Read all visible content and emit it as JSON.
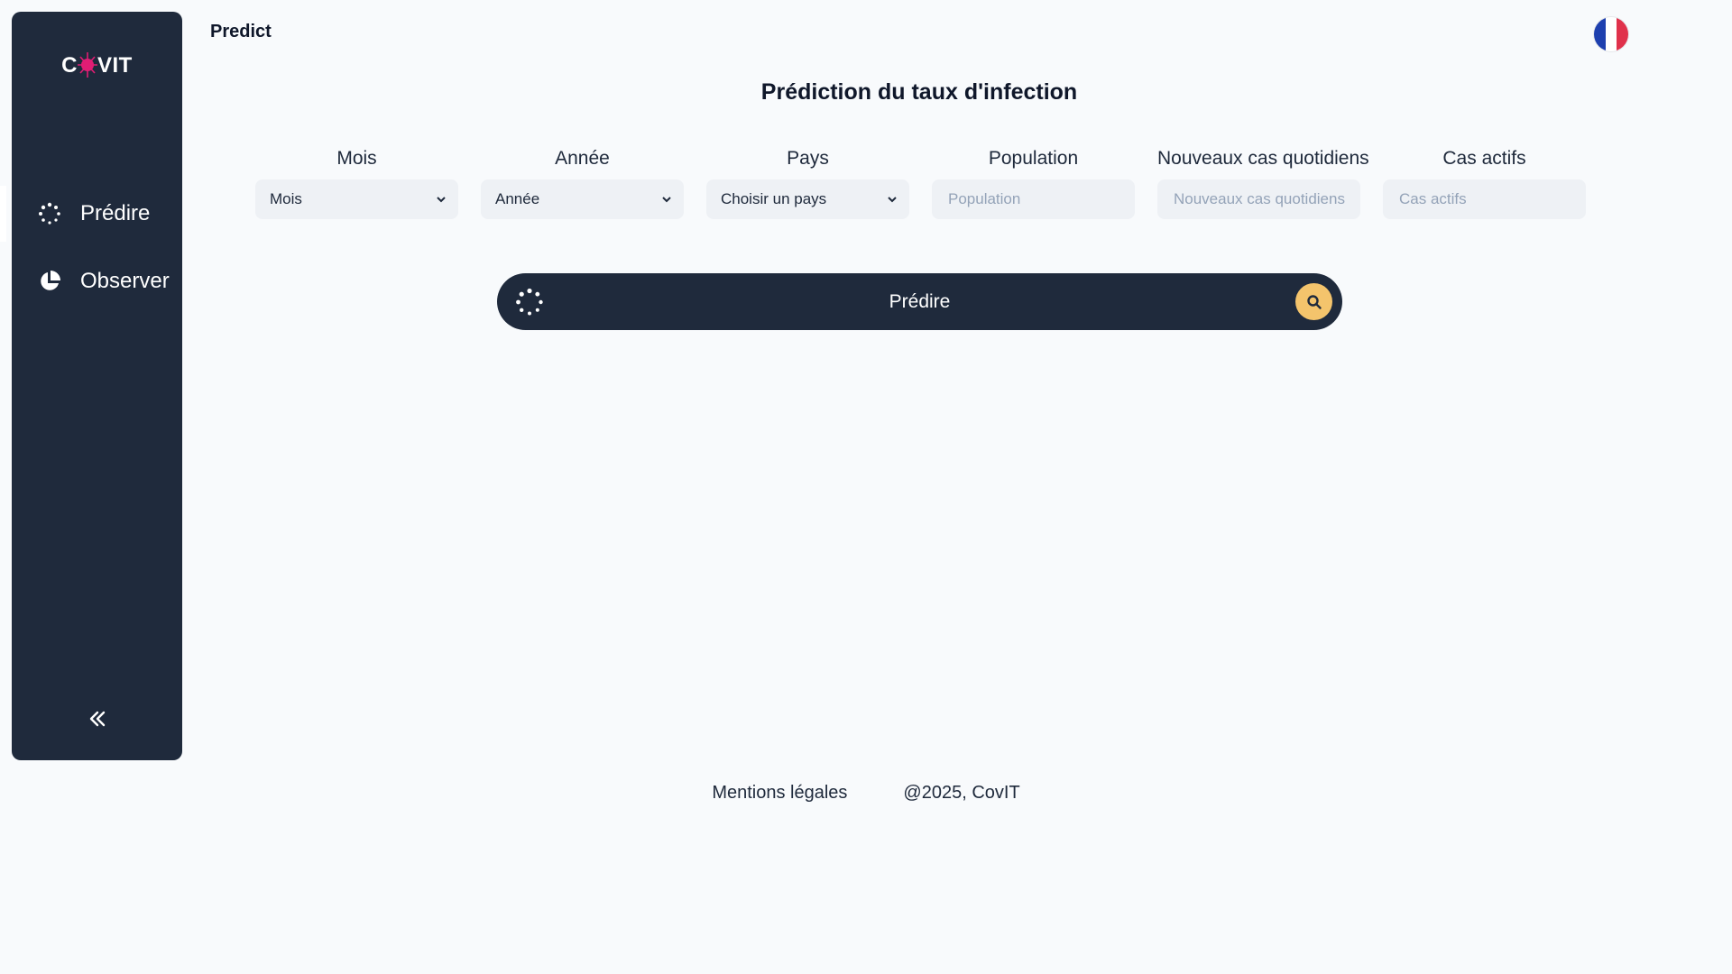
{
  "sidebar": {
    "logo": {
      "prefix": "C",
      "suffix": "VIT"
    },
    "items": [
      {
        "label": "Prédire",
        "icon": "loader-dots-icon",
        "active": true
      },
      {
        "label": "Observer",
        "icon": "pie-chart-icon",
        "active": false
      }
    ],
    "collapse_icon": "chevrons-left-icon"
  },
  "header": {
    "title": "Predict",
    "language_flag": "france-flag-icon"
  },
  "main": {
    "title": "Prédiction du taux d'infection",
    "fields": {
      "month": {
        "label": "Mois",
        "value": "Mois"
      },
      "year": {
        "label": "Année",
        "value": "Année"
      },
      "country": {
        "label": "Pays",
        "value": "Choisir un pays"
      },
      "population": {
        "label": "Population",
        "placeholder": "Population"
      },
      "new_cases": {
        "label": "Nouveaux cas quotidiens",
        "placeholder": "Nouveaux cas quotidiens"
      },
      "active_cases": {
        "label": "Cas actifs",
        "placeholder": "Cas actifs"
      }
    },
    "predict_button": {
      "label": "Prédire"
    }
  },
  "footer": {
    "legal": "Mentions légales",
    "copyright": "@2025, CovIT"
  },
  "colors": {
    "sidebar": "#1f2a3c",
    "background": "#f8fafc",
    "accent": "#f4c46c",
    "logo_virus": "#e11d74"
  }
}
